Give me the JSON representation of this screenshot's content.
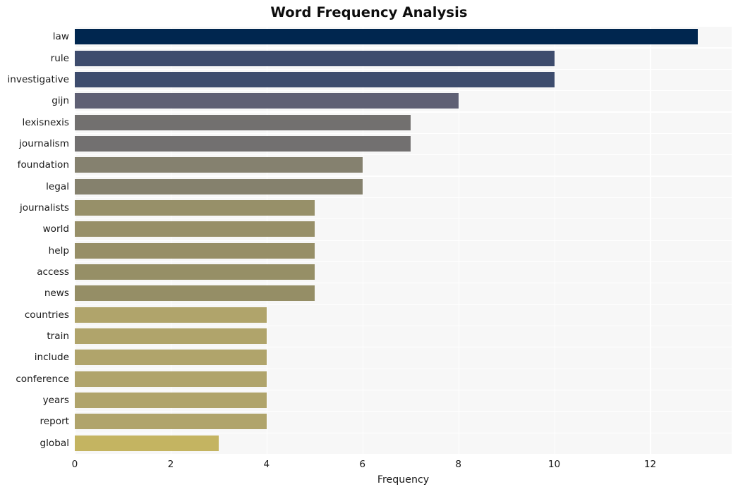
{
  "chart_data": {
    "type": "bar",
    "orientation": "horizontal",
    "title": "Word Frequency Analysis",
    "xlabel": "Frequency",
    "ylabel": "",
    "categories": [
      "law",
      "rule",
      "investigative",
      "gijn",
      "lexisnexis",
      "journalism",
      "foundation",
      "legal",
      "journalists",
      "world",
      "help",
      "access",
      "news",
      "countries",
      "train",
      "include",
      "conference",
      "years",
      "report",
      "global"
    ],
    "values": [
      13,
      10,
      10,
      8,
      7,
      7,
      6,
      6,
      5,
      5,
      5,
      5,
      5,
      4,
      4,
      4,
      4,
      4,
      4,
      3
    ],
    "bar_colors": [
      "#00264f",
      "#3e4c6d",
      "#3d4c6d",
      "#5f6074",
      "#72706f",
      "#727070",
      "#85816f",
      "#85816d",
      "#979069",
      "#978f68",
      "#978f67",
      "#968f66",
      "#958e66",
      "#b0a46b",
      "#b0a46b",
      "#b0a46b",
      "#b0a46b",
      "#b0a46b",
      "#b0a46b",
      "#c4b461"
    ],
    "xlim": [
      0,
      13.7
    ],
    "xticks": [
      0,
      2,
      4,
      6,
      8,
      10,
      12
    ],
    "xtick_labels": [
      "0",
      "2",
      "4",
      "6",
      "8",
      "10",
      "12"
    ],
    "grid": true,
    "grid_color": "#ffffff",
    "plot_background": "#f7f7f7",
    "figure_background": "#ffffff",
    "legend": null,
    "colormap": "cividis"
  }
}
